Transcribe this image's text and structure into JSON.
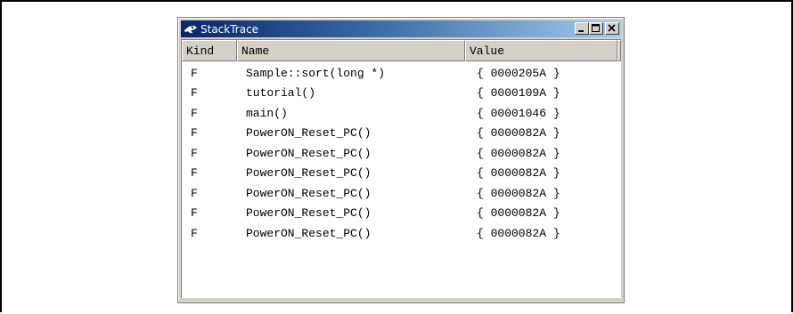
{
  "window": {
    "title": "StackTrace",
    "icon": "stacktrace-icon",
    "controls": [
      "minimize-icon",
      "maximize-icon",
      "close-icon"
    ]
  },
  "columns": {
    "kind": "Kind",
    "name": "Name",
    "value": "Value"
  },
  "rows": [
    {
      "kind": "F",
      "name": "Sample::sort(long *)",
      "value": "{ 0000205A }"
    },
    {
      "kind": "F",
      "name": "tutorial()",
      "value": "{ 0000109A }"
    },
    {
      "kind": "F",
      "name": "main()",
      "value": "{ 00001046 }"
    },
    {
      "kind": "F",
      "name": "PowerON_Reset_PC()",
      "value": "{ 0000082A }"
    },
    {
      "kind": "F",
      "name": "PowerON_Reset_PC()",
      "value": "{ 0000082A }"
    },
    {
      "kind": "F",
      "name": "PowerON_Reset_PC()",
      "value": "{ 0000082A }"
    },
    {
      "kind": "F",
      "name": "PowerON_Reset_PC()",
      "value": "{ 0000082A }"
    },
    {
      "kind": "F",
      "name": "PowerON_Reset_PC()",
      "value": "{ 0000082A }"
    },
    {
      "kind": "F",
      "name": "PowerON_Reset_PC()",
      "value": "{ 0000082A }"
    }
  ],
  "colors": {
    "titlebar_start": "#0a246a",
    "titlebar_end": "#a6caf0",
    "chrome": "#d4d0c8"
  }
}
